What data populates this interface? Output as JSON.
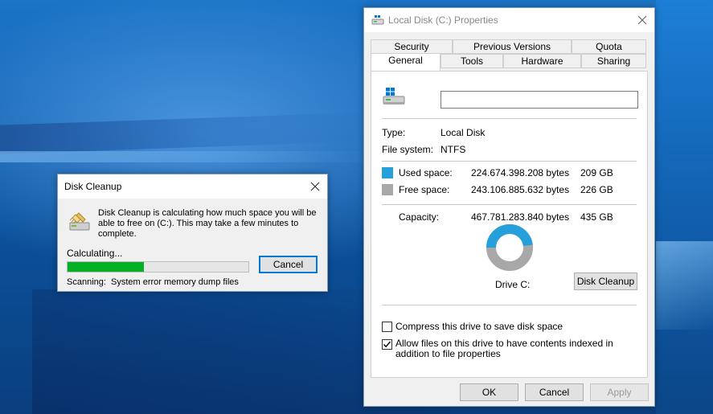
{
  "colors": {
    "used_space": "#26a0da",
    "free_space": "#a8a8a8",
    "progress": "#06b025",
    "accent": "#0078d7"
  },
  "cleanup_dialog": {
    "title": "Disk Cleanup",
    "message": "Disk Cleanup is calculating how much space you will be able to free on  (C:). This may take a few minutes to complete.",
    "status": "Calculating...",
    "progress": 0.42,
    "cancel_label": "Cancel",
    "scanning_label": "Scanning:",
    "scanning_value": "System error memory dump files"
  },
  "properties": {
    "title": "Local Disk (C:) Properties",
    "tabs_top": [
      "Security",
      "Previous Versions",
      "Quota"
    ],
    "tabs_bottom": [
      "General",
      "Tools",
      "Hardware",
      "Sharing"
    ],
    "active_tab": "General",
    "name_value": "",
    "type_label": "Type:",
    "type_value": "Local Disk",
    "fs_label": "File system:",
    "fs_value": "NTFS",
    "used_label": "Used space:",
    "used_bytes": "224.674.398.208 bytes",
    "used_gb": "209 GB",
    "free_label": "Free space:",
    "free_bytes": "243.106.885.632 bytes",
    "free_gb": "226 GB",
    "capacity_label": "Capacity:",
    "capacity_bytes": "467.781.283.840 bytes",
    "capacity_gb": "435 GB",
    "used_fraction": 0.48,
    "drive_label": "Drive C:",
    "disk_cleanup_label": "Disk Cleanup",
    "compress_label": "Compress this drive to save disk space",
    "compress_checked": false,
    "index_label": "Allow files on this drive to have contents indexed in addition to file properties",
    "index_checked": true,
    "ok_label": "OK",
    "cancel_label": "Cancel",
    "apply_label": "Apply"
  },
  "icons": {
    "close": "close-icon",
    "drive": "drive-icon",
    "cleanup": "disk-cleanup-icon",
    "check": "checkmark-icon"
  }
}
